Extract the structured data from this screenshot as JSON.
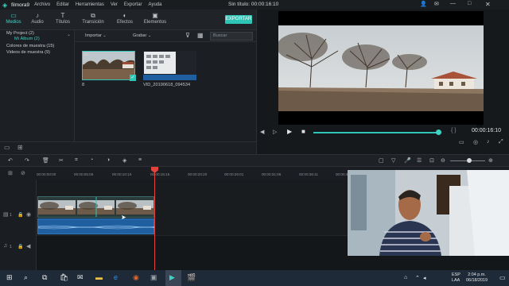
{
  "app": {
    "name": "filmora9",
    "menu": [
      "Archivo",
      "Editar",
      "Herramientas",
      "Ver",
      "Exportar",
      "Ayuda"
    ],
    "document_title": "Sin título:",
    "timecode": "00:00:16:10"
  },
  "top_tabs": [
    {
      "label": "Medios",
      "icon": "folder-icon",
      "active": true
    },
    {
      "label": "Audio",
      "icon": "music-note-icon",
      "active": false
    },
    {
      "label": "Títulos",
      "icon": "text-t-icon",
      "active": false
    },
    {
      "label": "Transición",
      "icon": "transition-icon",
      "active": false
    },
    {
      "label": "Efectos",
      "icon": "effects-icon",
      "active": false
    },
    {
      "label": "Elementos",
      "icon": "elements-icon",
      "active": false
    }
  ],
  "export_label": "EXPORTAR",
  "sidebar": {
    "items": [
      "My Project (2)",
      "Mi Álbum (2)",
      "Colores de muestra (15)",
      "Videos de muestra (9)"
    ]
  },
  "media_bar": {
    "import_label": "Importar",
    "record_label": "Grabar",
    "search_placeholder": "Buscar"
  },
  "media_items": [
    {
      "label": "8",
      "checked": true
    },
    {
      "label": "VID_20190618_094534",
      "checked": false
    }
  ],
  "preview": {
    "time": "00:00:16:10",
    "progress": 0.99
  },
  "ruler_ticks": [
    "00:00:00:00",
    "00:00:05:05",
    "00:00:10:10",
    "00:00:15:15",
    "00:00:20:20",
    "00:00:26:01",
    "00:00:31:06",
    "00:00:36:11",
    "00:00:4"
  ],
  "tracks": {
    "video_label": "1",
    "audio_label": "1"
  },
  "taskbar": {
    "lang": "ESP",
    "lang2": "LAA",
    "time": "2:04 p.m.",
    "date": "06/18/2019"
  },
  "colors": {
    "accent": "#2ec4b6",
    "playhead": "#e0423c",
    "audio_clip": "#1f5fa0"
  }
}
